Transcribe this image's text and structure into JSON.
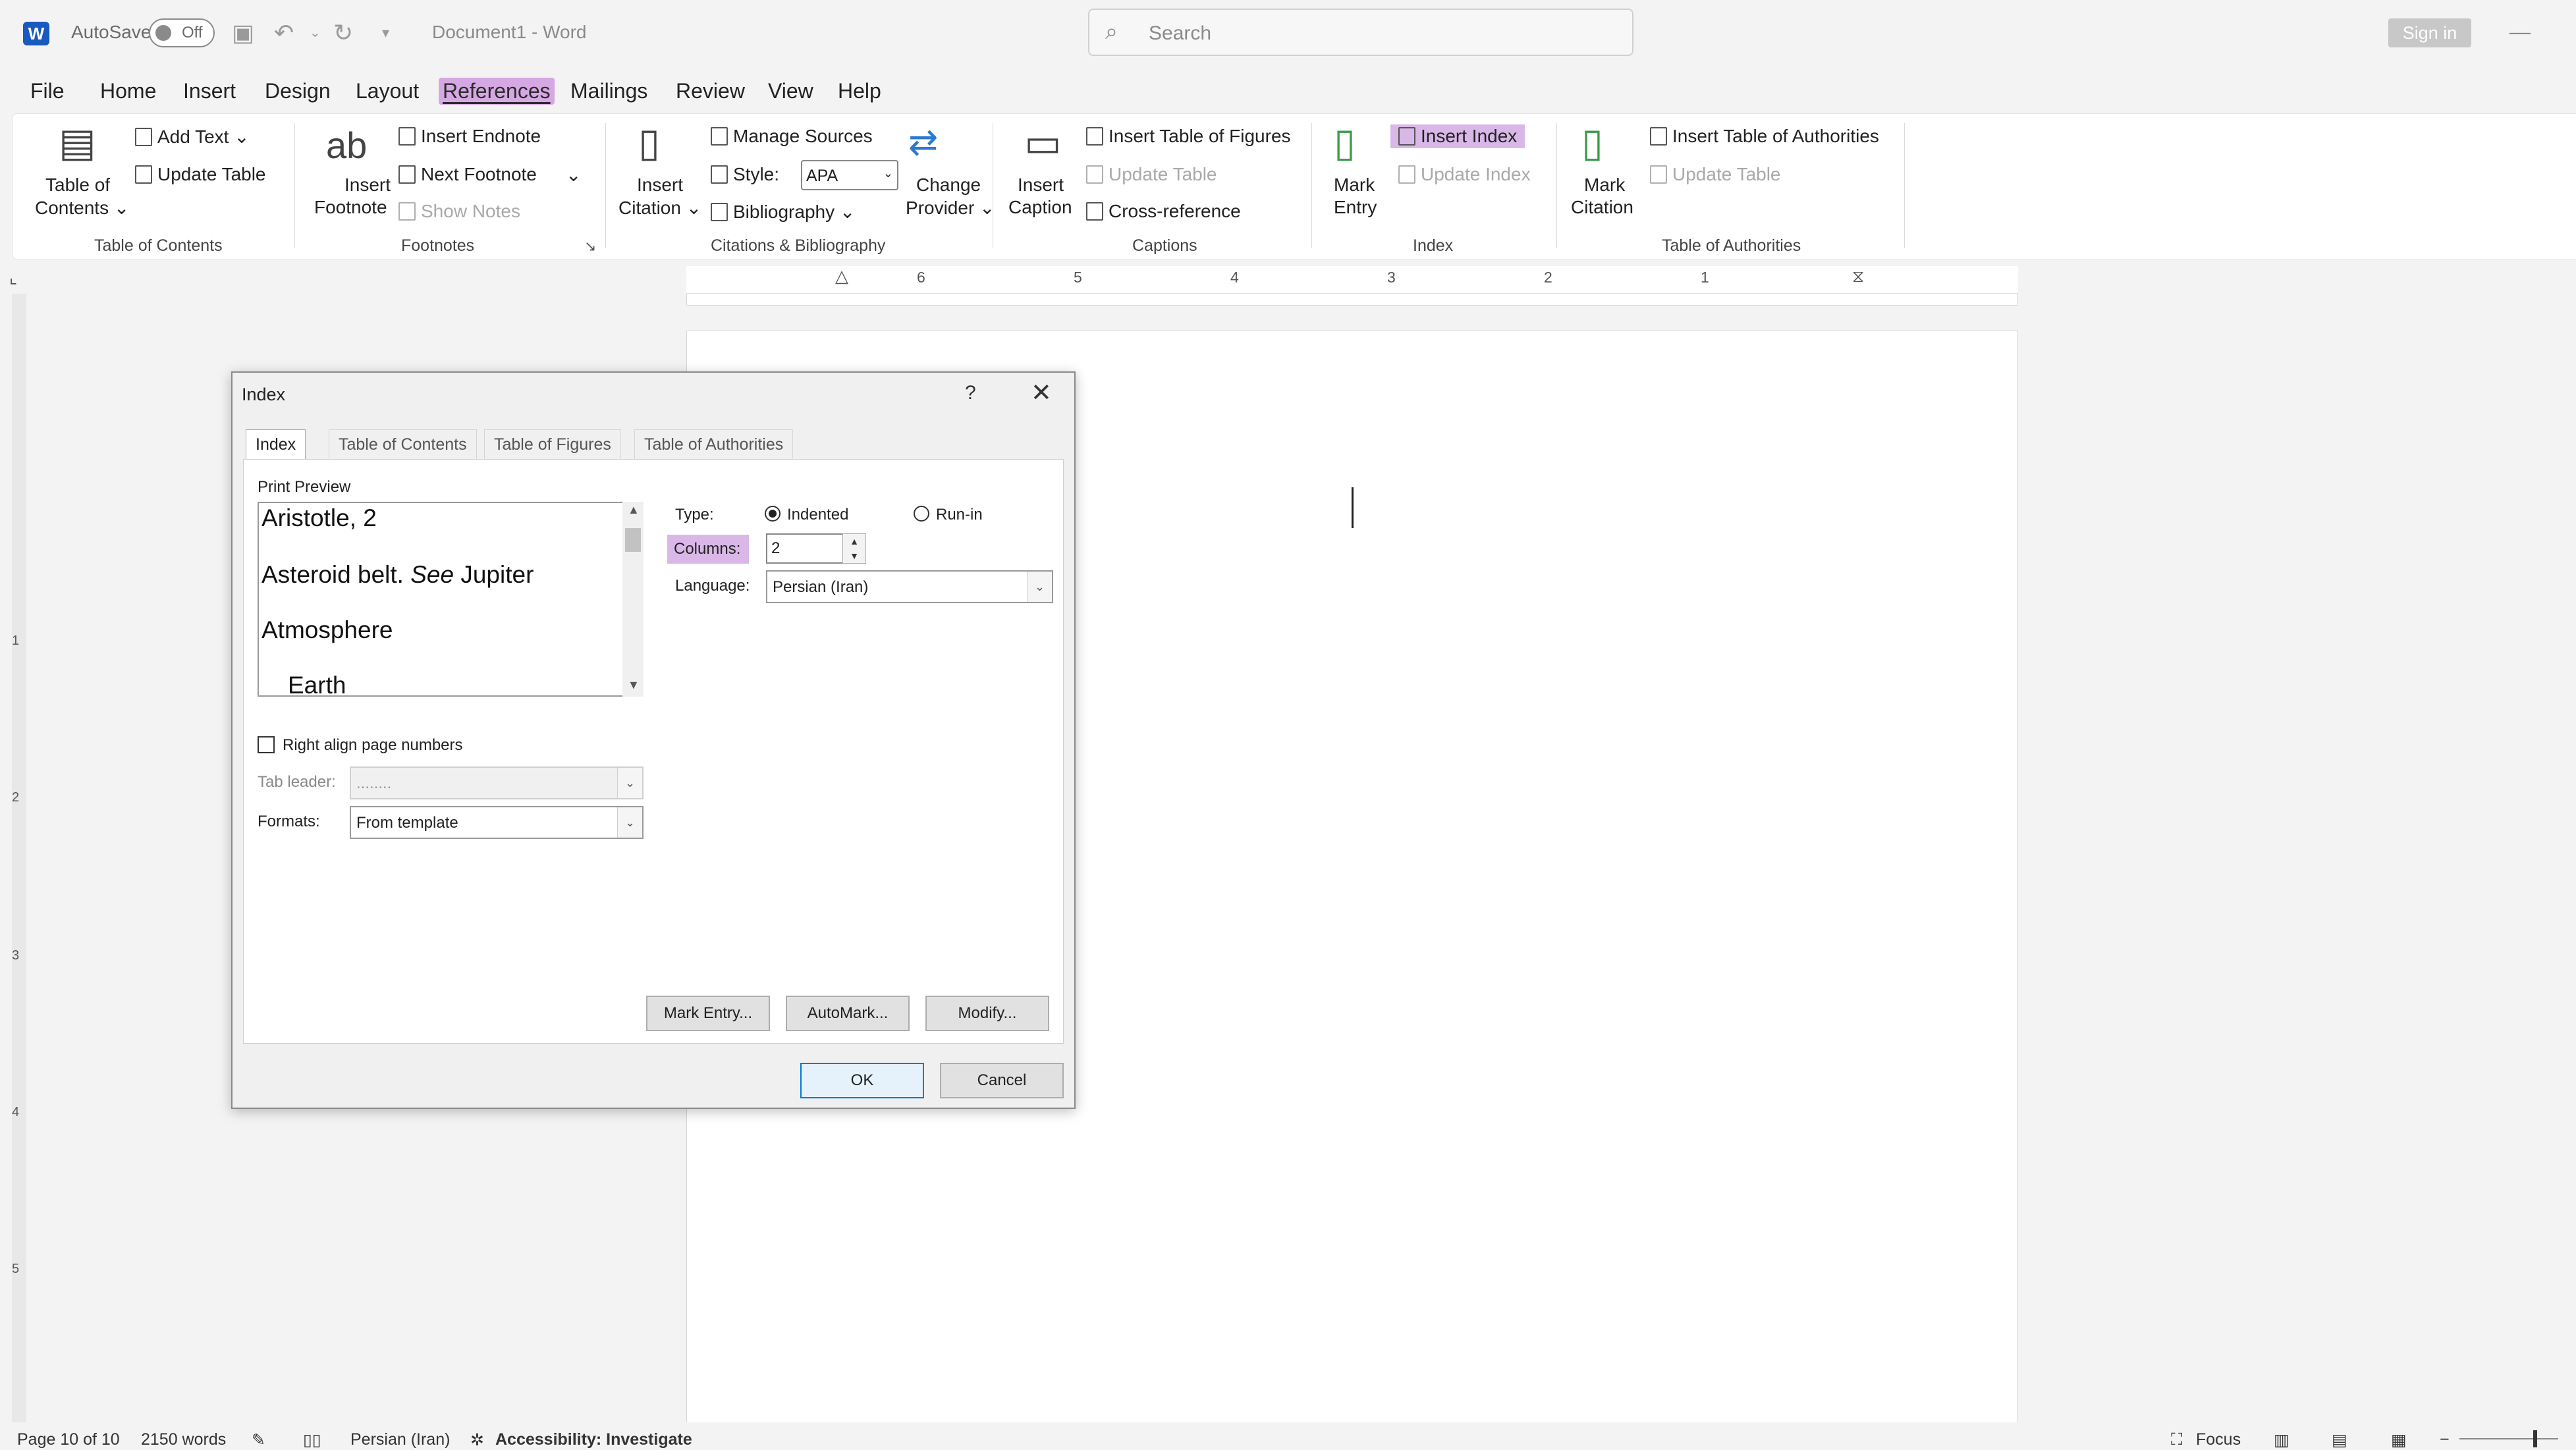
{
  "titlebar": {
    "logo_letter": "W",
    "autosave_label": "AutoSave",
    "autosave_state": "Off",
    "doc_title": "Document1  -  Word",
    "search_placeholder": "Search",
    "signin_label": "Sign in",
    "minimize": "—"
  },
  "menu": {
    "tabs": [
      "File",
      "Home",
      "Insert",
      "Design",
      "Layout",
      "References",
      "Mailings",
      "Review",
      "View",
      "Help"
    ],
    "active": "References"
  },
  "ribbon": {
    "toc": {
      "table_of_contents": "Table of",
      "table_of_contents2": "Contents ⌄",
      "add_text": "Add Text ⌄",
      "update_table": "Update Table",
      "group": "Table of Contents"
    },
    "footnotes": {
      "insert_footnote": "Insert",
      "insert_footnote2": "Footnote",
      "insert_endnote": "Insert Endnote",
      "next_footnote": "Next Footnote",
      "next_footnote_dropdown": "⌄",
      "show_notes": "Show Notes",
      "group": "Footnotes"
    },
    "citations": {
      "insert_citation": "Insert",
      "insert_citation2": "Citation ⌄",
      "manage_sources": "Manage Sources",
      "style_label": "Style:",
      "style_value": "APA",
      "bibliography": "Bibliography ⌄",
      "change_provider": "Change",
      "change_provider2": "Provider ⌄",
      "group": "Citations & Bibliography"
    },
    "captions": {
      "insert_caption": "Insert",
      "insert_caption2": "Caption",
      "insert_tof": "Insert Table of Figures",
      "update_table": "Update Table",
      "cross_reference": "Cross-reference",
      "group": "Captions"
    },
    "index": {
      "mark_entry": "Mark",
      "mark_entry2": "Entry",
      "insert_index": "Insert Index",
      "update_index": "Update Index",
      "group": "Index"
    },
    "authorities": {
      "mark_citation": "Mark",
      "mark_citation2": "Citation",
      "insert_toa": "Insert Table of Authorities",
      "update_table": "Update Table",
      "group": "Table of Authorities"
    }
  },
  "ruler": {
    "numbers": [
      "6",
      "5",
      "4",
      "3",
      "2",
      "1"
    ],
    "vertical_numbers": [
      "1",
      "2",
      "3",
      "4",
      "5"
    ]
  },
  "dialog": {
    "title": "Index",
    "help": "?",
    "close": "✕",
    "tabs": [
      "Index",
      "Table of Contents",
      "Table of Figures",
      "Table of Authorities"
    ],
    "active_tab": "Index",
    "print_preview_label": "Print Preview",
    "preview": {
      "line1": "Aristotle, 2",
      "line2_a": "Asteroid belt.",
      "line2_b": "See",
      "line2_c": "Jupiter",
      "line3": "Atmosphere",
      "line4": "Earth"
    },
    "type_label": "Type:",
    "type_indented": "Indented",
    "type_runin": "Run-in",
    "type_selected": "Indented",
    "columns_label": "Columns:",
    "columns_value": "2",
    "language_label": "Language:",
    "language_value": "Persian (Iran)",
    "right_align_label": "Right align page numbers",
    "right_align_checked": false,
    "tab_leader_label": "Tab leader:",
    "tab_leader_value": "........",
    "formats_label": "Formats:",
    "formats_value": "From template",
    "mark_entry_btn": "Mark Entry...",
    "automark_btn": "AutoMark...",
    "modify_btn": "Modify...",
    "ok_btn": "OK",
    "cancel_btn": "Cancel"
  },
  "statusbar": {
    "page": "Page 10 of 10",
    "words": "2150 words",
    "language": "Persian (Iran)",
    "accessibility": "Accessibility: Investigate",
    "focus": "Focus"
  },
  "colors": {
    "accent_highlight": "#d9b8e8",
    "word_blue": "#185abd",
    "ok_border": "#0078d4"
  }
}
